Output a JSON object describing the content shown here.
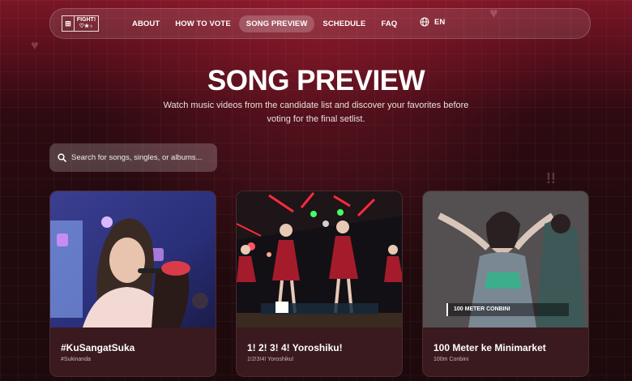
{
  "nav": {
    "logo_text": "FIGHT!",
    "links": [
      {
        "label": "ABOUT"
      },
      {
        "label": "HOW TO VOTE"
      },
      {
        "label": "SONG PREVIEW",
        "active": true
      },
      {
        "label": "SCHEDULE"
      },
      {
        "label": "FAQ"
      }
    ],
    "language": "EN"
  },
  "page": {
    "title": "SONG PREVIEW",
    "subtitle": "Watch music videos from the candidate list and discover your favorites before voting for the final setlist."
  },
  "search": {
    "placeholder": "Search for songs, singles, or albums..."
  },
  "cards": [
    {
      "title": "#KuSangatSuka",
      "subtitle": "#Sukinanda"
    },
    {
      "title": "1! 2! 3! 4! Yoroshiku!",
      "subtitle": "1!2!3!4! Yoroshiku!"
    },
    {
      "title": "100 Meter ke Minimarket",
      "subtitle": "100m Conbini",
      "video_caption": "100 METER CONBINI"
    }
  ],
  "colors": {
    "background_top": "#7a1626",
    "background_bottom": "#1d090c",
    "card_bg": "#3a1a1f"
  }
}
